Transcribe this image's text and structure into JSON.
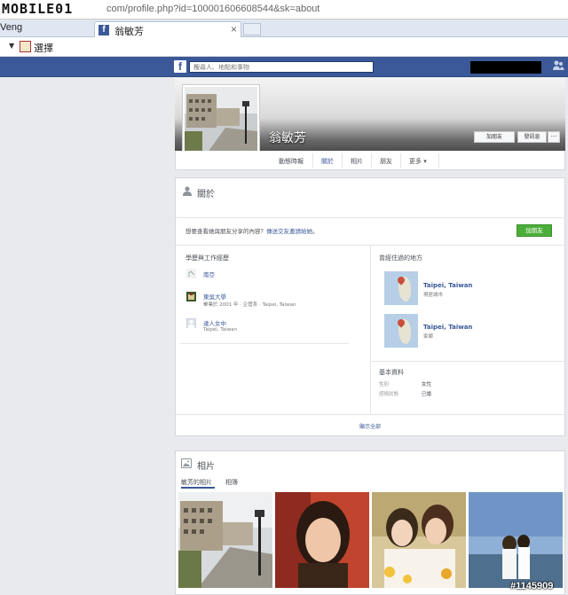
{
  "browser": {
    "logo": "MOBILE01",
    "url": "com/profile.php?id=100001606608544&sk=about",
    "prev_tab": "Veng",
    "active_tab_title": "翁敏芳",
    "tab_close": "×",
    "bookmark_label": "選擇"
  },
  "fb": {
    "logo_letter": "f",
    "search_placeholder": "搜尋人、地點和事物"
  },
  "profile": {
    "name": "翁敏芳",
    "add_friend": "加朋友",
    "message": "發訊息",
    "more": "···",
    "tabs": [
      "動態時報",
      "關於",
      "相片",
      "朋友",
      "更多 ▾"
    ]
  },
  "about": {
    "title": "關於",
    "note_prefix": "想要查看她與朋友分享的內容？",
    "note_link": "傳送交友邀請給她",
    "note_suffix": "。",
    "add_friend_btn": "加朋友",
    "edu_title": "學歷與工作經歷",
    "edu": [
      {
        "name": "南亞",
        "sub": ""
      },
      {
        "name": "東吳大學",
        "sub": "畢業於 2001 年 · 企管系 · Taipei, Taiwan"
      },
      {
        "name": "達人女中",
        "sub": "Taipei, Taiwan"
      }
    ],
    "places_title": "曾經住過的地方",
    "places": [
      {
        "name": "Taipei, Taiwan",
        "sub": "現居城市"
      },
      {
        "name": "Taipei, Taiwan",
        "sub": "家鄉"
      }
    ],
    "basic_title": "基本資料",
    "basic": [
      {
        "label": "性別",
        "value": "女性"
      },
      {
        "label": "感情狀態",
        "value": "已婚"
      }
    ],
    "show_all": "顯示全部"
  },
  "photos": {
    "title": "相片",
    "tab_own": "敏芳的相片",
    "tab_albums": "相簿"
  },
  "watermark": "#1145909"
}
